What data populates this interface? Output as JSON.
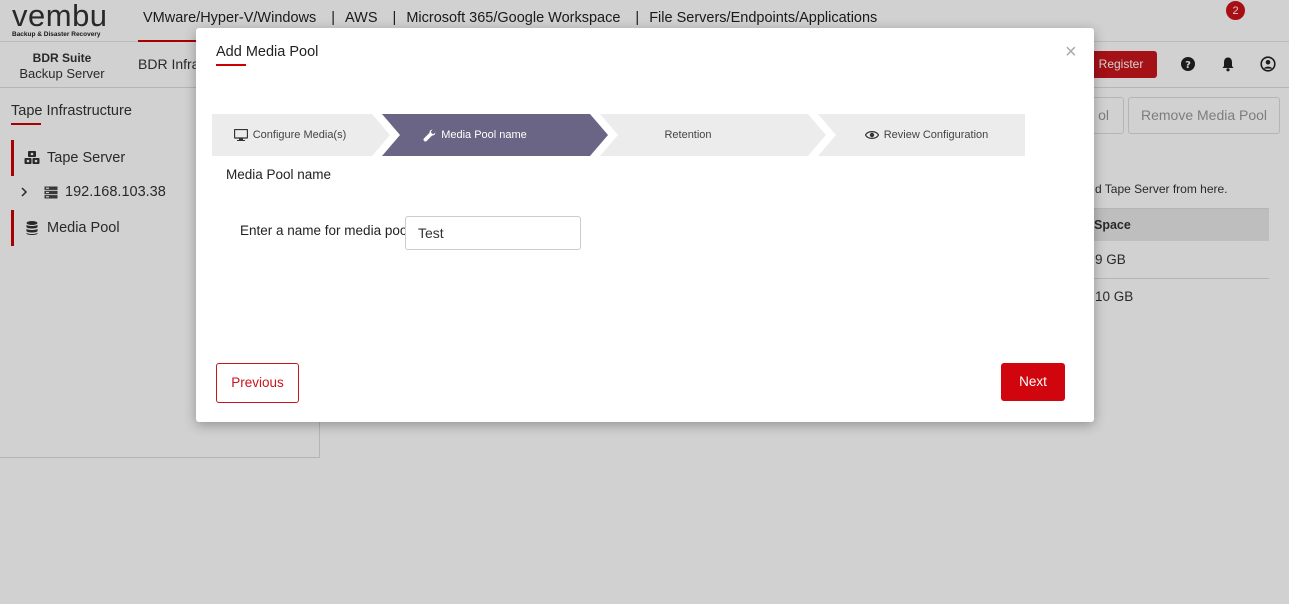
{
  "app": {
    "logo_word": "vembu",
    "logo_tagline": "Backup & Disaster Recovery",
    "top_nav": [
      "VMware/Hyper-V/Windows",
      "AWS",
      "Microsoft 365/Google Workspace",
      "File Servers/Endpoints/Applications"
    ],
    "top_nav_separator": "|",
    "suite_line1": "BDR Suite",
    "suite_line2": "Backup Server",
    "sub_nav_label": "BDR Infra",
    "register_label": "Register",
    "notification_count": "2",
    "accent_color": "#c8151b"
  },
  "sidebar": {
    "title": "Tape Infrastructure",
    "items": [
      {
        "label": "Tape Server",
        "icon": "tape-server-icon"
      },
      {
        "label": "192.168.103.38",
        "icon": "server-icon"
      },
      {
        "label": "Media Pool",
        "icon": "database-icon"
      }
    ]
  },
  "background_main": {
    "btn_partial": "ol",
    "btn_remove": "Remove Media Pool",
    "hint_text": "d Tape Server from here.",
    "column_header": "Space",
    "rows": [
      "9 GB",
      "10 GB"
    ]
  },
  "modal": {
    "title": "Add Media Pool",
    "close_symbol": "×",
    "steps": [
      {
        "label": "Configure Media(s)",
        "icon": "monitor-icon",
        "state": "done"
      },
      {
        "label": "Media Pool name",
        "icon": "wrench-icon",
        "state": "active"
      },
      {
        "label": "Retention",
        "icon": "",
        "state": "pending"
      },
      {
        "label": "Review Configuration",
        "icon": "eye-icon",
        "state": "pending"
      }
    ],
    "section_title": "Media Pool name",
    "field_label": "Enter a name for media pool:",
    "field_value": "Test",
    "previous_label": "Previous",
    "next_label": "Next",
    "step_active_color": "#6b6585",
    "step_inactive_color": "#ececec"
  }
}
